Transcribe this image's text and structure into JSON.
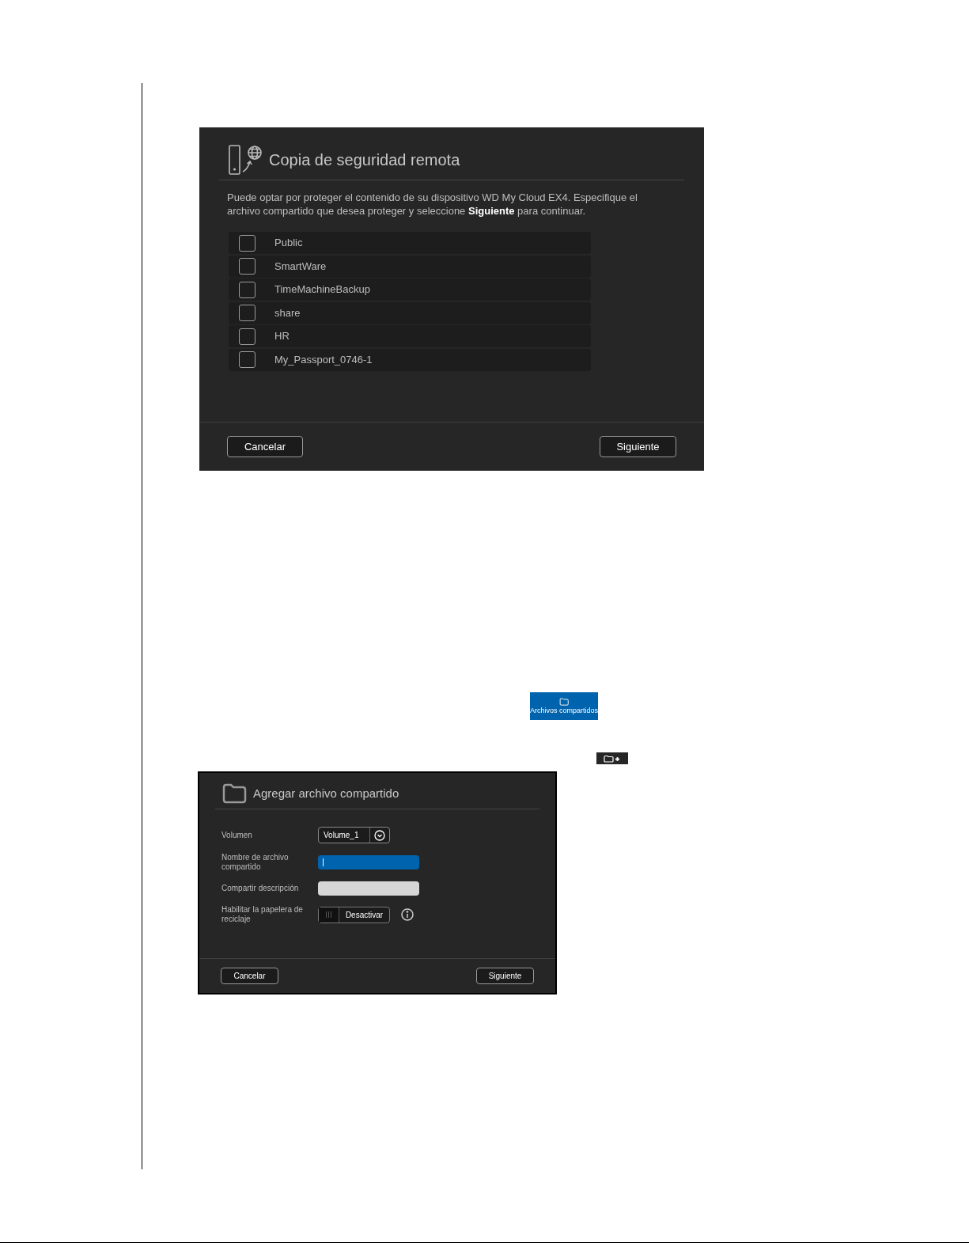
{
  "remote_backup_dialog": {
    "title": "Copia de seguridad remota",
    "description": "Puede optar por proteger el contenido de su dispositivo WD My Cloud EX4. Especifique el archivo compartido que desea proteger y seleccione **Siguiente** para continuar.",
    "shares": [
      {
        "name": "Public",
        "checked": false
      },
      {
        "name": "SmartWare",
        "checked": false
      },
      {
        "name": "TimeMachineBackup",
        "checked": false
      },
      {
        "name": "share",
        "checked": false
      },
      {
        "name": "HR",
        "checked": false
      },
      {
        "name": "My_Passport_0746-1",
        "checked": false
      }
    ],
    "buttons": [
      "Cancelar",
      "Siguiente"
    ]
  },
  "shares_button": {
    "label": "Archivos compartidos"
  },
  "add_share_dialog": {
    "title": "Agregar archivo compartido",
    "fields": [
      {
        "kind": "select",
        "label": "Volumen",
        "value": "Volume_1"
      },
      {
        "kind": "text",
        "label": "Nombre de archivo compartido",
        "focused": true
      },
      {
        "kind": "text",
        "label": "Compartir descripción",
        "focused": false
      },
      {
        "kind": "toggle",
        "label": "Habilitar la papelera de reciclaje",
        "on": false,
        "state_label": "Desactivar"
      }
    ],
    "buttons": [
      "Cancelar",
      "Siguiente"
    ]
  }
}
